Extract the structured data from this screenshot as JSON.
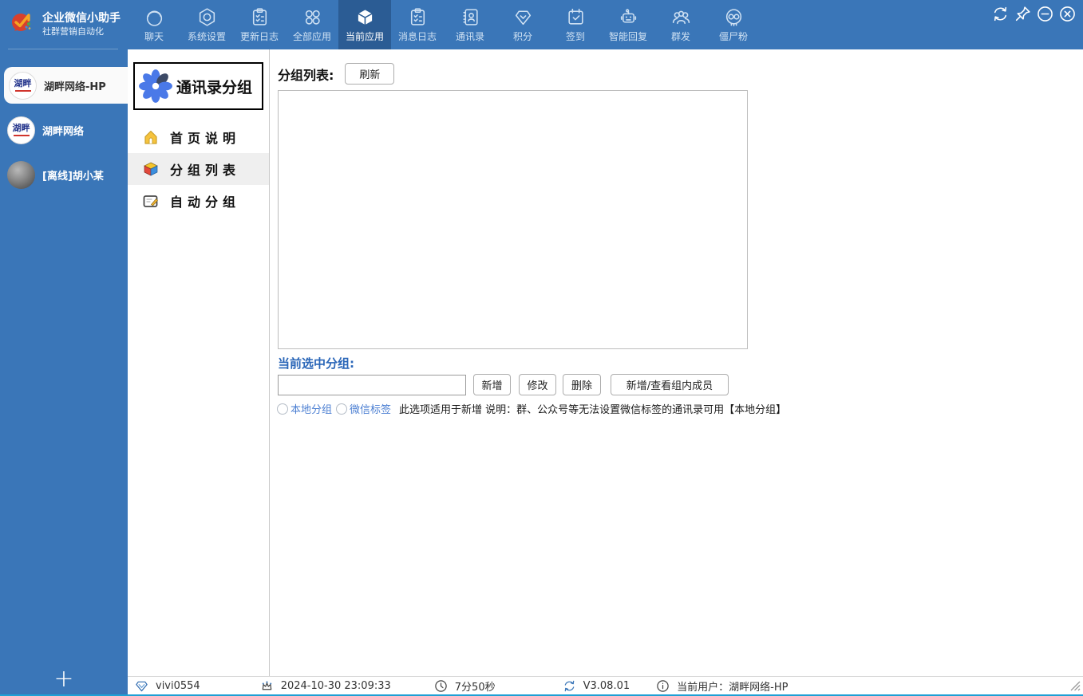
{
  "brand": {
    "title": "企业微信小助手",
    "subtitle": "社群营销自动化"
  },
  "topnav": [
    {
      "label": "聊天",
      "active": false
    },
    {
      "label": "系统设置",
      "active": false
    },
    {
      "label": "更新日志",
      "active": false
    },
    {
      "label": "全部应用",
      "active": false
    },
    {
      "label": "当前应用",
      "active": true
    },
    {
      "label": "消息日志",
      "active": false
    },
    {
      "label": "通讯录",
      "active": false
    },
    {
      "label": "积分",
      "active": false
    },
    {
      "label": "签到",
      "active": false
    },
    {
      "label": "智能回复",
      "active": false
    },
    {
      "label": "群发",
      "active": false
    },
    {
      "label": "僵尸粉",
      "active": false
    }
  ],
  "window_controls": {
    "refresh": "refresh",
    "pin": "pin",
    "minimize": "minimize",
    "close": "close"
  },
  "sidebar": {
    "accounts": [
      {
        "name": "湖畔网络-HP",
        "avatar_text": "湖畔",
        "active": true
      },
      {
        "name": "湖畔网络",
        "avatar_text": "湖畔",
        "active": false
      },
      {
        "name": "[离线]胡小某",
        "avatar_text": "",
        "active": false
      }
    ],
    "add_button": "+"
  },
  "panel": {
    "title": "通讯录分组",
    "menu": [
      {
        "label": "首页说明",
        "icon": "home-icon",
        "active": false
      },
      {
        "label": "分组列表",
        "icon": "box-icon",
        "active": true
      },
      {
        "label": "自动分组",
        "icon": "tablet-pencil-icon",
        "active": false
      }
    ]
  },
  "main": {
    "list_label": "分组列表:",
    "refresh_button": "刷新",
    "selected_label": "当前选中分组:",
    "group_input": {
      "value": "",
      "placeholder": ""
    },
    "actions": {
      "add": "新增",
      "edit": "修改",
      "delete": "删除",
      "members": "新增/查看组内成员"
    },
    "radio_local": "本地分组",
    "radio_wechat": "微信标签",
    "hint": "此选项适用于新增  说明：群、公众号等无法设置微信标签的通讯录可用【本地分组】"
  },
  "statusbar": {
    "account": "vivi0554",
    "datetime": "2024-10-30 23:09:33",
    "uptime": "7分50秒",
    "version": "V3.08.01",
    "current_user": "当前用户：湖畔网络-HP"
  },
  "colors": {
    "bar_blue": "#3a76b8",
    "active_blue": "#2b5c94",
    "accent_cyan": "#1ea0d5",
    "label_blue": "#2a66b8",
    "radio_blue": "#4a7ed2"
  }
}
